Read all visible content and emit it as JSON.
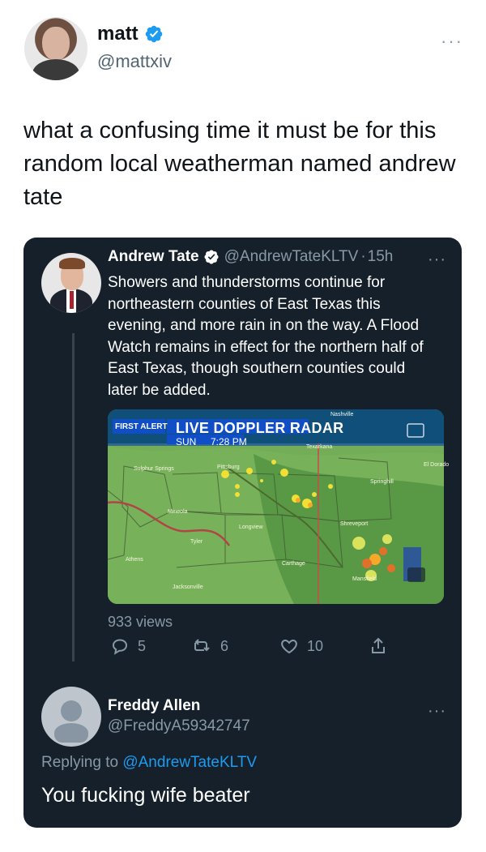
{
  "author": {
    "name": "matt",
    "handle": "@mattxiv",
    "more": "···"
  },
  "tweet": {
    "text": "what a confusing time it must be for this random local weatherman named andrew tate"
  },
  "quoted": {
    "name": "Andrew Tate",
    "handle": "@AndrewTateKLTV",
    "separator": "·",
    "time": "15h",
    "more": "···",
    "text": "Showers and thunderstorms continue for northeastern counties of East Texas this evening, and more rain in on the way. A Flood Watch remains in effect for the northern half of East Texas, though southern counties could later be added.",
    "media": {
      "logo": "FIRST ALERT",
      "title": "LIVE DOPPLER RADAR",
      "day": "SUN",
      "time": "7:28 PM",
      "places": [
        "Sulphur Springs",
        "Pittsburg",
        "Texarkana",
        "Nashville",
        "El Dorado",
        "Springhill",
        "Mineola",
        "Longview",
        "Shreveport",
        "Tyler",
        "Athens",
        "Carthage",
        "Mansfield",
        "Jacksonville"
      ]
    },
    "views": "933 views",
    "replies": "5",
    "retweets": "6",
    "likes": "10"
  },
  "reply": {
    "name": "Freddy Allen",
    "handle": "@FreddyA59342747",
    "more": "···",
    "replying_label": "Replying to ",
    "replying_to": "@AndrewTateKLTV",
    "text": "You fucking wife beater"
  },
  "colors": {
    "card_bg": "#15202b",
    "verified": "#1d9bf0",
    "muted": "#8899a6"
  }
}
